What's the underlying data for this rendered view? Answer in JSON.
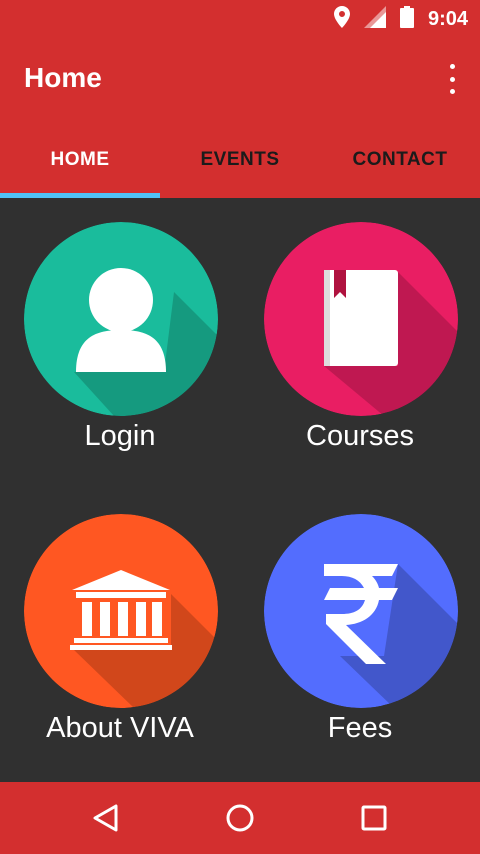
{
  "status_bar": {
    "time": "9:04",
    "icons": [
      "location-icon",
      "signal-icon",
      "battery-icon"
    ]
  },
  "toolbar": {
    "title": "Home",
    "menu_icon": "more-vert-icon"
  },
  "tabs": [
    {
      "label": "HOME",
      "active": true
    },
    {
      "label": "EVENTS",
      "active": false
    },
    {
      "label": "CONTACT",
      "active": false
    }
  ],
  "tiles": [
    {
      "label": "Login",
      "icon": "user-icon",
      "color": "#1abc9c"
    },
    {
      "label": "Courses",
      "icon": "book-icon",
      "color": "#e91e63"
    },
    {
      "label": "About VIVA",
      "icon": "institution-icon",
      "color": "#ff5722"
    },
    {
      "label": "Fees",
      "icon": "rupee-icon",
      "color": "#536dfe"
    }
  ],
  "nav_bar": {
    "buttons": [
      "back-icon",
      "home-icon",
      "recents-icon"
    ]
  },
  "colors": {
    "primary": "#d32f2f",
    "tab_indicator": "#4fc3f7",
    "background": "#303030"
  }
}
